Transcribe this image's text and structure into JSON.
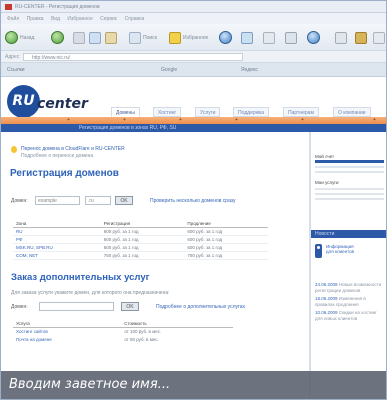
{
  "caption": "Вводим заветное имя...",
  "browser": {
    "title": "RU-CENTER - Регистрация доменов",
    "menu": [
      "Файл",
      "Правка",
      "Вид",
      "Избранное",
      "Сервис",
      "Справка"
    ],
    "back_label": "Назад",
    "forward_label": "",
    "search_label": "Поиск",
    "favorites_label": "Избранное",
    "address_label": "Адрес",
    "address_value": "http://www.nic.ru/",
    "links": [
      "Ссылки",
      "Google",
      "Яндекс"
    ]
  },
  "site": {
    "logo_ru": "RU",
    "logo_center": "center",
    "nav_tabs": [
      "Домены",
      "Хостинг",
      "Услуги",
      "Поддержка",
      "Партнерам",
      "О компании"
    ],
    "orange_bar": [
      "+",
      "+",
      "+",
      "+",
      "+",
      "+"
    ],
    "blue_bar": "Регистрация доменов в зонах RU, РФ, SU",
    "promo_line1": "Перенос домена в CloudFlare и RU-CENTER",
    "promo_line2": "Подробнее о переносе домена",
    "h_registration": "Регистрация доменов",
    "domain_label": "Домен:",
    "domain_input": "example",
    "zone_select": ".ru",
    "check_button": "OK",
    "bulk_link": "Проверить несколько доменов сразу",
    "price_table": {
      "headers": [
        "Зона",
        "Регистрация",
        "Продление"
      ],
      "rows": [
        [
          "RU",
          "600 руб. за 1 год",
          "600 руб. за 1 год"
        ],
        [
          "РФ",
          "600 руб. за 1 год",
          "600 руб. за 1 год"
        ],
        [
          "MSK.RU, SPB.RU",
          "600 руб. за 1 год",
          "600 руб. за 1 год"
        ],
        [
          "COM, NET",
          "750 руб. за 1 год",
          "750 руб. за 1 год"
        ]
      ]
    },
    "h_additional": "Заказ дополнительных услуг",
    "additional_text": "Для заказа услуги укажите домен, для которого она предназначена:",
    "add_domain_label": "Домен:",
    "add_button": "OK",
    "add_link": "Подробнее о дополнительных услугах",
    "services_table": {
      "headers": [
        "Услуга",
        "Стоимость"
      ],
      "rows": [
        [
          "Хостинг сайтов",
          "от 100 руб. в мес."
        ],
        [
          "Почта на домене",
          "от 50 руб. в мес."
        ]
      ]
    },
    "sidebar": {
      "block1_title": "Мой счет",
      "block2_title": "Мои услуги",
      "blue_header": "Новости",
      "info_text": "Информация",
      "info_text2": "для клиентов",
      "news": [
        {
          "date": "24.06.2009",
          "text": "Новые возможности регистрации доменов"
        },
        {
          "date": "18.06.2009",
          "text": "Изменения в правилах продления"
        },
        {
          "date": "10.06.2009",
          "text": "Скидки на хостинг для новых клиентов"
        }
      ]
    }
  }
}
